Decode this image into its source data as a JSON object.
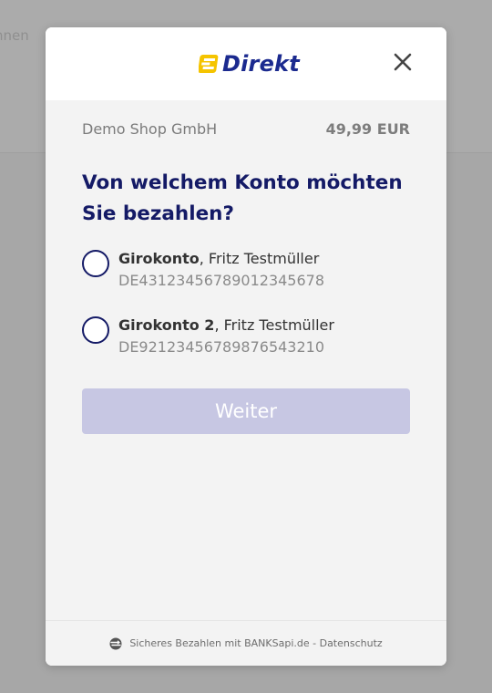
{
  "background": {
    "partial_text": "hnen"
  },
  "header": {
    "logo_text": "Direkt",
    "logo_icon": "euro-e-logo-icon",
    "close_icon": "close-icon",
    "brand_color": "#1b2a8f",
    "logo_accent": "#f5c400"
  },
  "merchant": {
    "name": "Demo Shop GmbH",
    "amount": "49,99 EUR"
  },
  "question": "Von welchem Konto möchten Sie bezahlen?",
  "accounts": [
    {
      "name": "Girokonto",
      "owner": ", Fritz Testmüller",
      "iban": "DE43123456789012345678",
      "selected": false
    },
    {
      "name": "Girokonto 2",
      "owner": ", Fritz Testmüller",
      "iban": "DE92123456789876543210",
      "selected": false
    }
  ],
  "continue_button": {
    "label": "Weiter",
    "enabled": false,
    "color": "#c7c7e3"
  },
  "footer": {
    "icon": "banksapi-icon",
    "text": "Sicheres Bezahlen mit BANKSapi.de",
    "separator": " - ",
    "privacy_link": "Datenschutz"
  }
}
